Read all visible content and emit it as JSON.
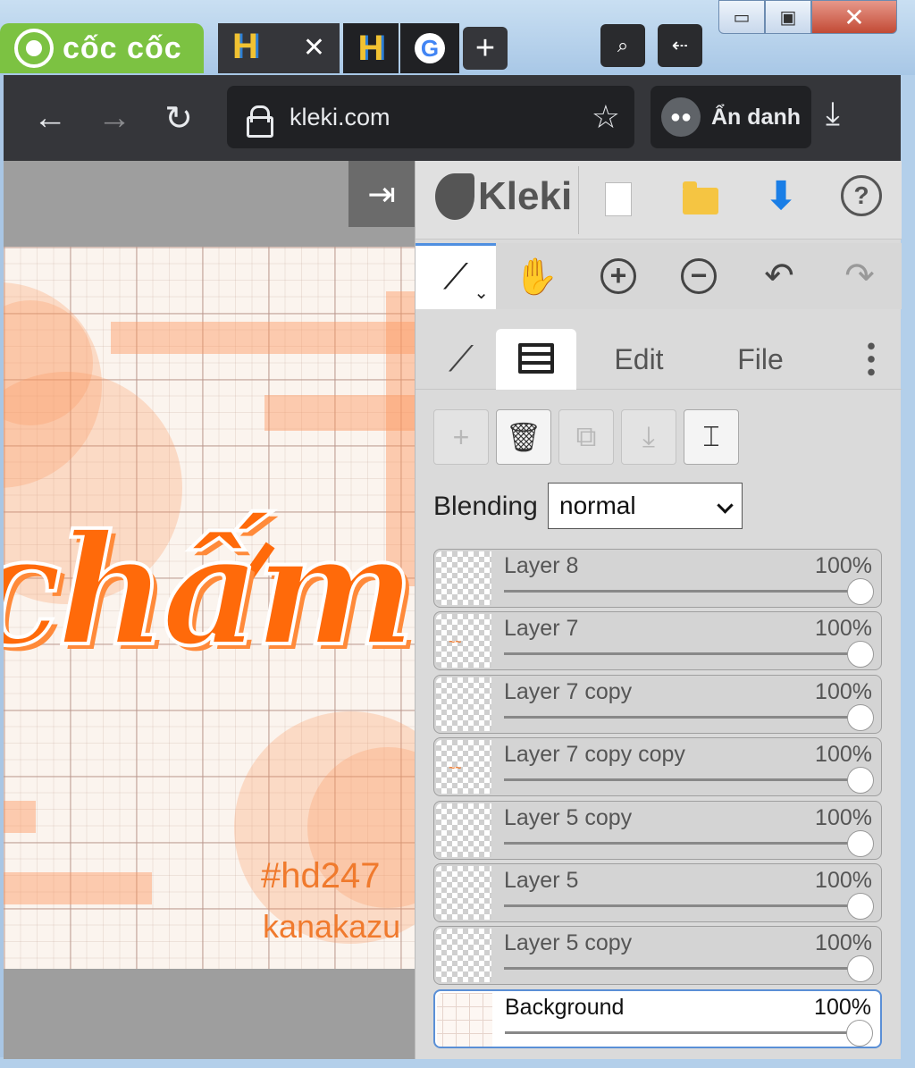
{
  "browser": {
    "brand_name": "cốc cốc",
    "new_tab_symbol": "+",
    "tab_close_symbol": "✕",
    "url": "kleki.com",
    "incognito_label": "Ẩn danh",
    "window_controls": {
      "minimize": "▭",
      "maximize": "▣",
      "close": "✕"
    }
  },
  "canvas": {
    "art_title": "chấm",
    "art_tag": "#hd247",
    "art_signature": "kanakazu",
    "colors": {
      "accent": "#ff6a0a",
      "paper": "#fbf4ee"
    }
  },
  "panel": {
    "logo_text": "Kleki",
    "tabs": {
      "edit": "Edit",
      "file": "File"
    },
    "blending_label": "Blending",
    "blending_value": "normal",
    "layers": [
      {
        "name": "Layer 8",
        "opacity": "100%"
      },
      {
        "name": "Layer 7",
        "opacity": "100%"
      },
      {
        "name": "Layer 7 copy",
        "opacity": "100%"
      },
      {
        "name": "Layer 7 copy copy",
        "opacity": "100%"
      },
      {
        "name": "Layer 5 copy",
        "opacity": "100%"
      },
      {
        "name": "Layer 5",
        "opacity": "100%"
      },
      {
        "name": "Layer 5 copy",
        "opacity": "100%"
      },
      {
        "name": "Background",
        "opacity": "100%"
      }
    ],
    "selected_layer": "Background",
    "accent_color": "#5a8fd6"
  }
}
